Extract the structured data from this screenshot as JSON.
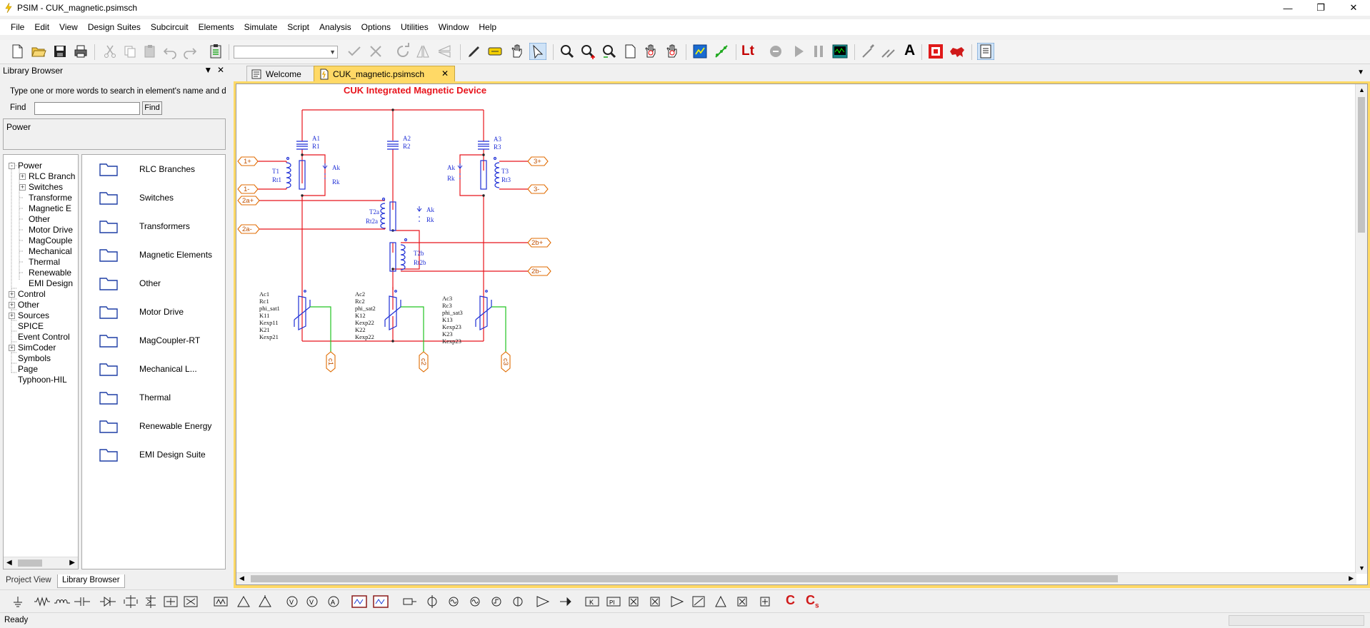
{
  "window": {
    "title": "PSIM - CUK_magnetic.psimsch"
  },
  "menubar": {
    "items": [
      "File",
      "Edit",
      "View",
      "Design Suites",
      "Subcircuit",
      "Elements",
      "Simulate",
      "Script",
      "Analysis",
      "Options",
      "Utilities",
      "Window",
      "Help"
    ]
  },
  "toolbar": {
    "lt_label": "Lt",
    "text_label": "A",
    "combo_value": ""
  },
  "library": {
    "title": "Library Browser",
    "description": "Type one or more words to search in element's name and  desc",
    "find_label": "Find",
    "find_value": "",
    "find_button": "Find",
    "path": "Power",
    "tree": [
      {
        "label": "Power",
        "box": "-"
      },
      {
        "label": "RLC Branch",
        "box": "+"
      },
      {
        "label": "Switches",
        "box": "+"
      },
      {
        "label": "Transforme",
        "box": ""
      },
      {
        "label": "Magnetic E",
        "box": ""
      },
      {
        "label": "Other",
        "box": ""
      },
      {
        "label": "Motor Drive",
        "box": ""
      },
      {
        "label": "MagCouple",
        "box": ""
      },
      {
        "label": "Mechanical",
        "box": ""
      },
      {
        "label": "Thermal",
        "box": ""
      },
      {
        "label": "Renewable",
        "box": ""
      },
      {
        "label": "EMI Design",
        "box": ""
      },
      {
        "label": "Control",
        "box": "+"
      },
      {
        "label": "Other",
        "box": "+"
      },
      {
        "label": "Sources",
        "box": "+"
      },
      {
        "label": "SPICE",
        "box": ""
      },
      {
        "label": "Event Control",
        "box": ""
      },
      {
        "label": "SimCoder",
        "box": "+"
      },
      {
        "label": "Symbols",
        "box": ""
      },
      {
        "label": "Page",
        "box": ""
      },
      {
        "label": "Typhoon-HIL",
        "box": ""
      }
    ],
    "folders": [
      "RLC Branches",
      "Switches",
      "Transformers",
      "Magnetic Elements",
      "Other",
      "Motor Drive",
      "MagCoupler-RT",
      "Mechanical L...",
      "Thermal",
      "Renewable Energy",
      "EMI Design Suite"
    ],
    "bottom_tabs": [
      "Project View",
      "Library Browser"
    ]
  },
  "document": {
    "tabs": [
      "Welcome",
      "CUK_magnetic.psimsch"
    ],
    "active_tab": "CUK_magnetic.psimsch"
  },
  "schematic": {
    "title": "CUK Integrated Magnetic Device",
    "ports": [
      "1+",
      "1-",
      "2a+",
      "2a-",
      "2b+",
      "2b-",
      "3+",
      "3-",
      "c1",
      "c2",
      "c3"
    ],
    "labels": {
      "a1": "A1",
      "r1": "R1",
      "a2": "A2",
      "r2": "R2",
      "a3": "A3",
      "r3": "R3",
      "t1": "T1",
      "rt1": "Rt1",
      "t3": "T3",
      "rt3": "Rt3",
      "t2a": "T2a",
      "rt2a": "Rt2a",
      "t2b": "T2b",
      "rt2b": "Rt2b",
      "ak": "Ak",
      "rk": "Rk"
    },
    "core_labels": [
      [
        "Ac1",
        "Rc1",
        "phi_sat1",
        "K11",
        "Kexp11",
        "K21",
        "Kexp21"
      ],
      [
        "Ac2",
        "Rc2",
        "phi_sat2",
        "K12",
        "Kexp22",
        "K22",
        "Kexp22"
      ],
      [
        "Ac3",
        "Rc3",
        "phi_sat3",
        "K13",
        "Kexp23",
        "K23",
        "Kexp23"
      ]
    ]
  },
  "colors": {
    "wire": "#e8141c",
    "element": "#1f2fd6",
    "port": "#e06b00",
    "control_wire": "#22c322",
    "accent": "#ffd966"
  },
  "status": {
    "text": "Ready"
  }
}
